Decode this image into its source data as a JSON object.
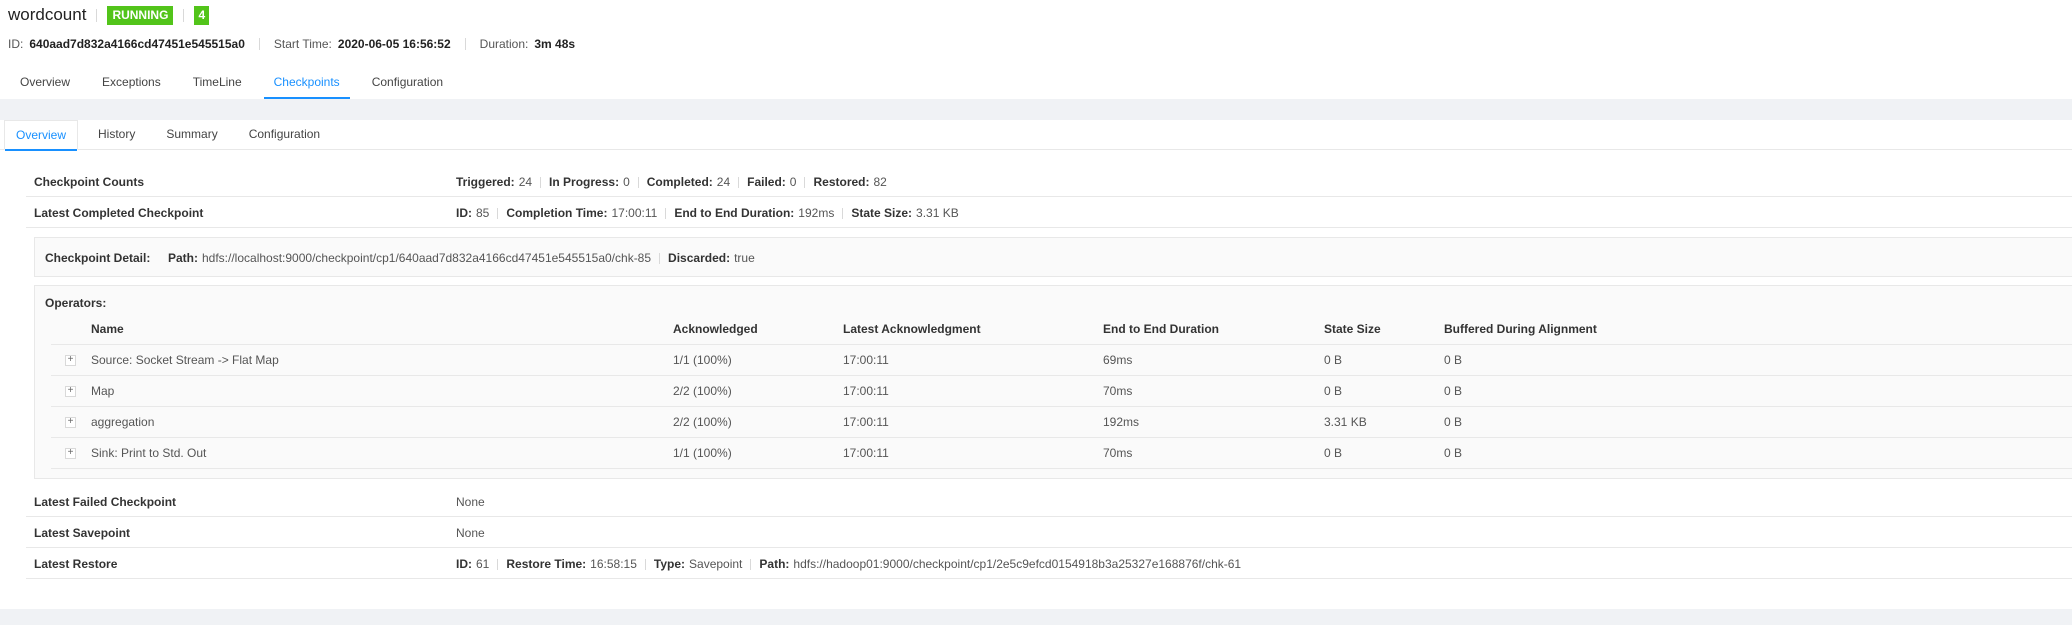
{
  "job": {
    "name": "wordcount",
    "status": "RUNNING",
    "task_count": "4",
    "id_label": "ID:",
    "id": "640aad7d832a4166cd47451e545515a0",
    "start_label": "Start Time:",
    "start_time": "2020-06-05 16:56:52",
    "duration_label": "Duration:",
    "duration": "3m 48s",
    "status_color": "#52c41a"
  },
  "job_tabs": [
    "Overview",
    "Exceptions",
    "TimeLine",
    "Checkpoints",
    "Configuration"
  ],
  "checkpoint_tabs": [
    "Overview",
    "History",
    "Summary",
    "Configuration"
  ],
  "counts": {
    "label": "Checkpoint Counts",
    "triggered_label": "Triggered:",
    "triggered": "24",
    "in_progress_label": "In Progress:",
    "in_progress": "0",
    "completed_label": "Completed:",
    "completed": "24",
    "failed_label": "Failed:",
    "failed": "0",
    "restored_label": "Restored:",
    "restored": "82"
  },
  "latest_completed": {
    "label": "Latest Completed Checkpoint",
    "id_label": "ID:",
    "id": "85",
    "completion_label": "Completion Time:",
    "completion_time": "17:00:11",
    "e2e_label": "End to End Duration:",
    "e2e": "192ms",
    "state_label": "State Size:",
    "state_size": "3.31 KB"
  },
  "detail": {
    "label": "Checkpoint Detail:",
    "path_label": "Path:",
    "path": "hdfs://localhost:9000/checkpoint/cp1/640aad7d832a4166cd47451e545515a0/chk-85",
    "discarded_label": "Discarded:",
    "discarded": "true"
  },
  "operators": {
    "label": "Operators:",
    "columns": {
      "name": "Name",
      "ack": "Acknowledged",
      "latest": "Latest Acknowledgment",
      "e2e": "End to End Duration",
      "state": "State Size",
      "buffered": "Buffered During Alignment"
    },
    "rows": [
      {
        "name": "Source: Socket Stream -> Flat Map",
        "ack": "1/1 (100%)",
        "latest": "17:00:11",
        "e2e": "69ms",
        "state": "0 B",
        "buffered": "0 B"
      },
      {
        "name": "Map",
        "ack": "2/2 (100%)",
        "latest": "17:00:11",
        "e2e": "70ms",
        "state": "0 B",
        "buffered": "0 B"
      },
      {
        "name": "aggregation",
        "ack": "2/2 (100%)",
        "latest": "17:00:11",
        "e2e": "192ms",
        "state": "3.31 KB",
        "buffered": "0 B"
      },
      {
        "name": "Sink: Print to Std. Out",
        "ack": "1/1 (100%)",
        "latest": "17:00:11",
        "e2e": "70ms",
        "state": "0 B",
        "buffered": "0 B"
      }
    ],
    "expand_symbol": "+"
  },
  "latest_failed": {
    "label": "Latest Failed Checkpoint",
    "value": "None"
  },
  "latest_savepoint": {
    "label": "Latest Savepoint",
    "value": "None"
  },
  "latest_restore": {
    "label": "Latest Restore",
    "id_label": "ID:",
    "id": "61",
    "restore_label": "Restore Time:",
    "restore_time": "16:58:15",
    "type_label": "Type:",
    "type": "Savepoint",
    "path_label": "Path:",
    "path": "hdfs://hadoop01:9000/checkpoint/cp1/2e5c9efcd0154918b3a25327e168876f/chk-61"
  }
}
